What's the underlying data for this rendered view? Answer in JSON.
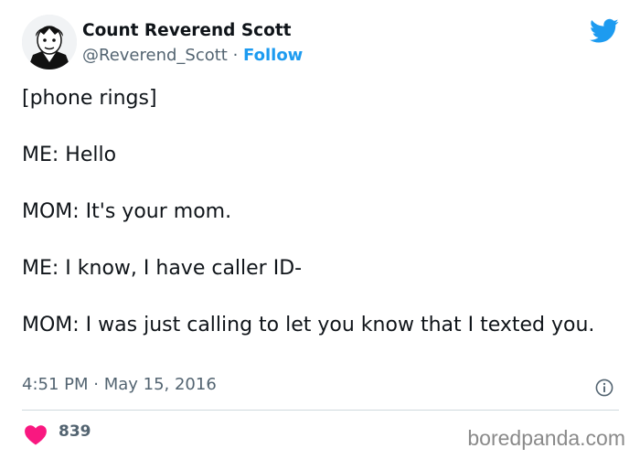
{
  "user": {
    "display_name": "Count Reverend Scott",
    "handle": "@Reverend_Scott",
    "separator": " · ",
    "follow_label": "Follow"
  },
  "tweet": {
    "lines": [
      "[phone rings]",
      "ME: Hello",
      "MOM: It's your mom.",
      "ME: I know, I have caller ID-",
      "MOM: I was just calling to let you know that I texted you."
    ],
    "timestamp": "4:51 PM · May 15, 2016"
  },
  "engagement": {
    "likes": "839"
  },
  "icons": {
    "brand": "twitter-bird-icon",
    "info": "info-icon",
    "like": "heart-icon"
  },
  "colors": {
    "accent": "#1d9bf0",
    "heart": "#f91880",
    "muted": "#536471"
  },
  "watermark": "boredpanda.com"
}
